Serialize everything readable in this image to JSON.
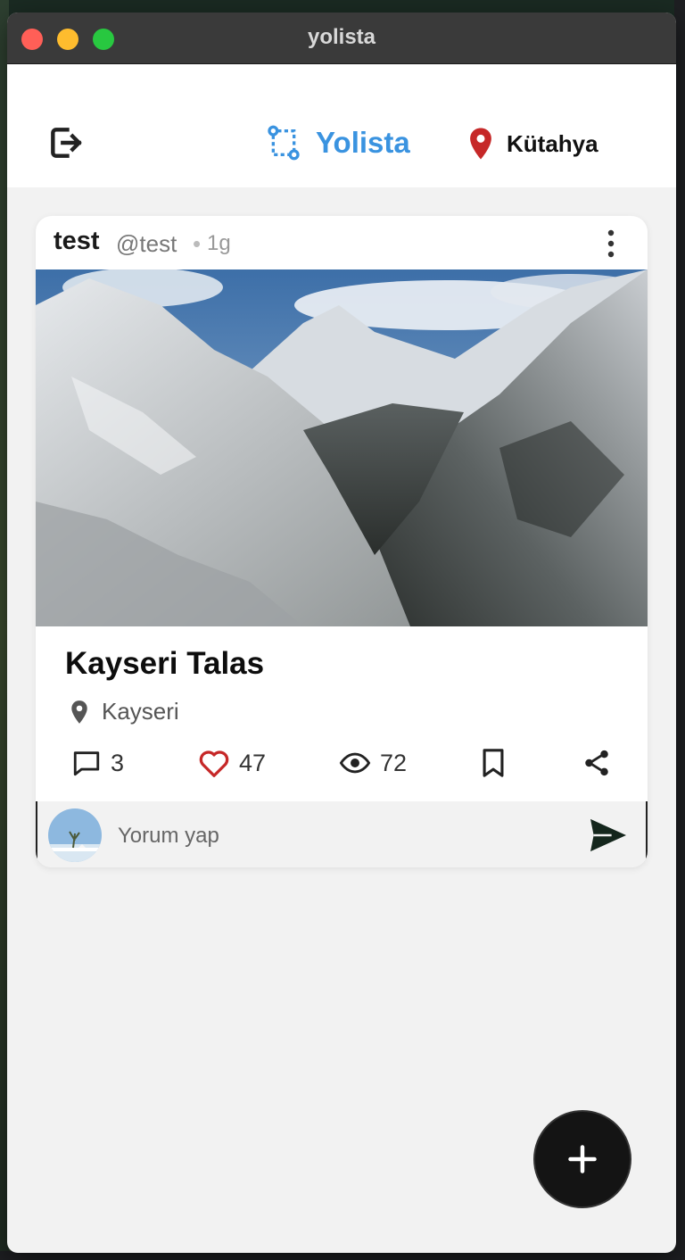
{
  "window": {
    "title": "yolista"
  },
  "header": {
    "brand": "Yolista",
    "location": "Kütahya",
    "icons": {
      "logout": "logout-icon",
      "brand": "route-icon",
      "location": "map-pin-icon"
    },
    "colors": {
      "brand": "#3a93e0",
      "location_pin": "#c62828"
    }
  },
  "post": {
    "author": "test",
    "handle": "@test",
    "separator": "•",
    "time": "1g",
    "title": "Kayseri Talas",
    "place": "Kayseri",
    "stats": {
      "comments": "3",
      "likes": "47",
      "views": "72"
    },
    "colors": {
      "like": "#c62828"
    }
  },
  "comment": {
    "placeholder": "Yorum yap"
  },
  "fab": {
    "icon": "plus-icon"
  }
}
